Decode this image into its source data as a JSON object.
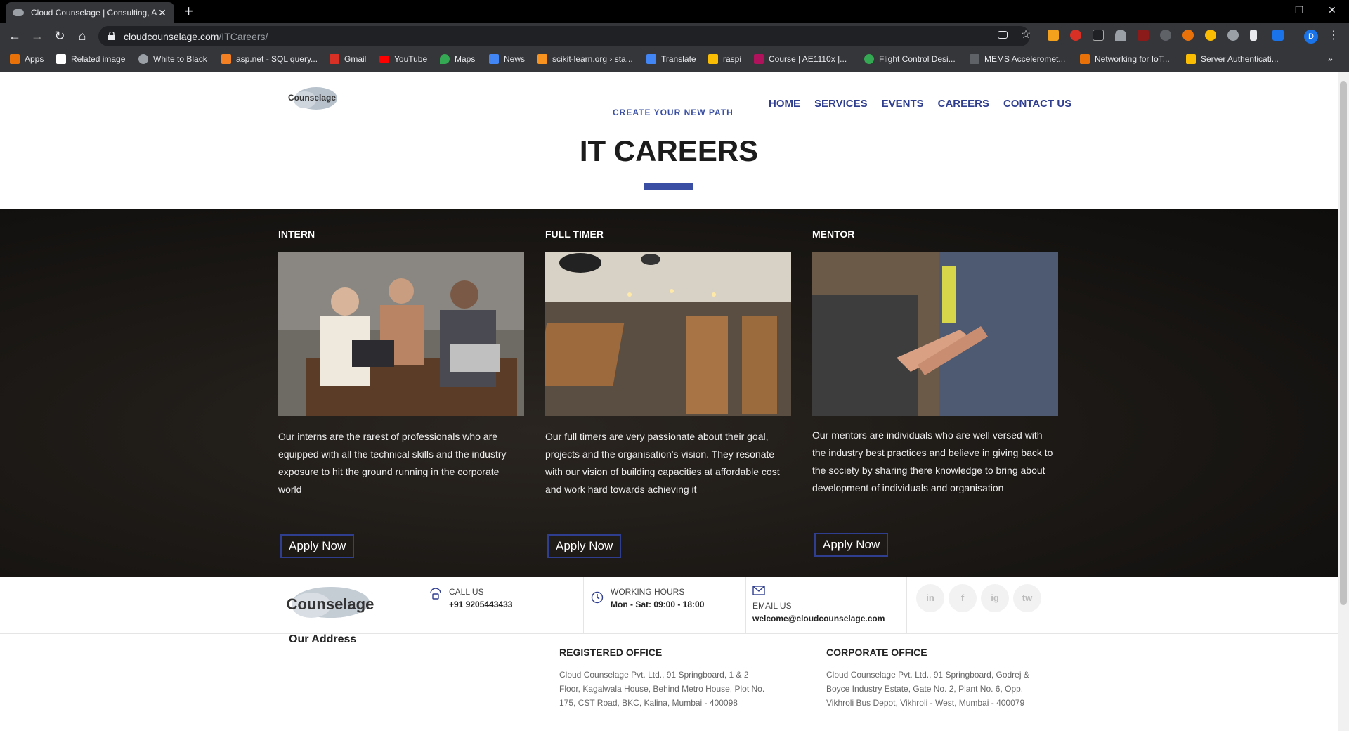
{
  "browser": {
    "tab_title": "Cloud Counselage | Consulting, A",
    "url_domain": "cloudcounselage.com",
    "url_path": "/ITCareers/",
    "profile_initial": "D",
    "bookmarks": [
      "Apps",
      "Related image",
      "White to Black",
      "asp.net - SQL query...",
      "Gmail",
      "YouTube",
      "Maps",
      "News",
      "scikit-learn.org › sta...",
      "Translate",
      "raspi",
      "Course | AE1110x |...",
      "Flight Control Desi...",
      "MEMS Acceleromet...",
      "Networking for IoT...",
      "Server Authenticati..."
    ]
  },
  "header": {
    "logo_text": "Counselage",
    "tagline": "CREATE YOUR NEW PATH",
    "nav": [
      "HOME",
      "SERVICES",
      "EVENTS",
      "CAREERS",
      "CONTACT US"
    ],
    "page_title": "IT CAREERS"
  },
  "cards": [
    {
      "title": "INTERN",
      "description": "Our interns are the rarest of professionals who are equipped with all the technical skills and the industry exposure to hit the ground running in the corporate world",
      "button": "Apply Now"
    },
    {
      "title": "FULL TIMER",
      "description": "Our full timers are very passionate about their goal, projects and the organisation's vision. They resonate with our vision of building capacities at affordable cost and work hard towards achieving it",
      "button": "Apply Now"
    },
    {
      "title": "MENTOR",
      "description": "Our mentors are individuals who are well versed with the industry best practices and believe in giving back to the society by sharing there knowledge to bring about development of individuals and organisation",
      "button": "Apply Now"
    }
  ],
  "contact": {
    "logo_text": "Counselage",
    "call_label": "CALL US",
    "call_value": "+91 9205443433",
    "hours_label": "WORKING HOURS",
    "hours_value": "Mon - Sat: 09:00 - 18:00",
    "email_label": "EMAIL US",
    "email_value": "welcome@cloudcounselage.com",
    "social": [
      "in",
      "f",
      "ig",
      "tw"
    ]
  },
  "address": {
    "title": "Our Address",
    "registered_title": "REGISTERED OFFICE",
    "registered_text": "Cloud Counselage Pvt. Ltd., 91 Springboard, 1 & 2 Floor, Kagalwala House, Behind Metro House, Plot No. 175, CST Road, BKC, Kalina, Mumbai - 400098",
    "corporate_title": "CORPORATE OFFICE",
    "corporate_text": "Cloud Counselage Pvt. Ltd., 91 Springboard, Godrej & Boyce Industry Estate, Gate No. 2, Plant No. 6, Opp. Vikhroli Bus Depot, Vikhroli - West, Mumbai - 400079"
  },
  "colors": {
    "accent": "#2f3e8f",
    "hero_bg": "#1a1714"
  }
}
